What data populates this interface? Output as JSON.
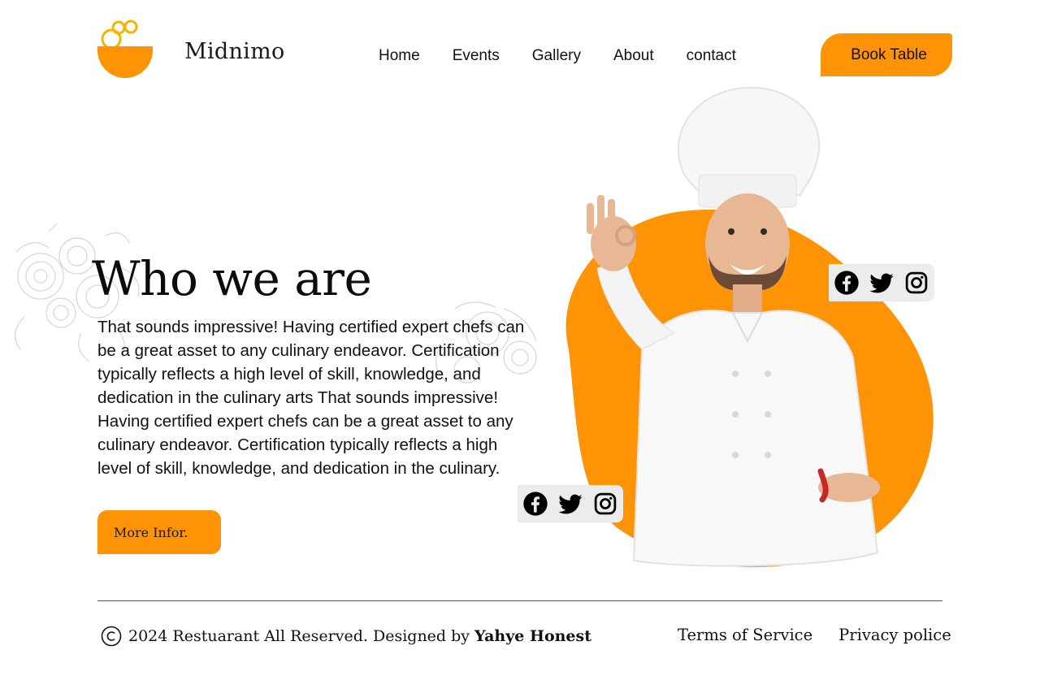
{
  "brand": {
    "name": "Midnimo",
    "accent": "#fe9305",
    "logo_icon": "bowl-logo-icon"
  },
  "nav": {
    "items": [
      {
        "label": "Home"
      },
      {
        "label": "Events"
      },
      {
        "label": "Gallery"
      },
      {
        "label": "About"
      },
      {
        "label": "contact"
      }
    ],
    "cta_label": "Book Table"
  },
  "hero": {
    "heading": "Who we are",
    "paragraph": "That sounds impressive! Having certified expert chefs can be a great asset to any culinary endeavor. Certification typically reflects a high level of skill, knowledge, and dedication in the culinary arts That sounds impressive! Having certified expert chefs can be a great asset to any culinary endeavor. Certification typically reflects a high level of skill, knowledge, and dedication in the culinary.",
    "button_label": "More Infor.",
    "image_icon": "chef-ok-gesture-photo",
    "social_icons": [
      "facebook-icon",
      "twitter-icon",
      "instagram-icon"
    ]
  },
  "footer": {
    "copyright_prefix": "2024 Restuarant All Reserved. Designed by",
    "designer": "Yahye Honest",
    "links": [
      {
        "label": "Terms of Service"
      },
      {
        "label": "Privacy police"
      }
    ]
  }
}
